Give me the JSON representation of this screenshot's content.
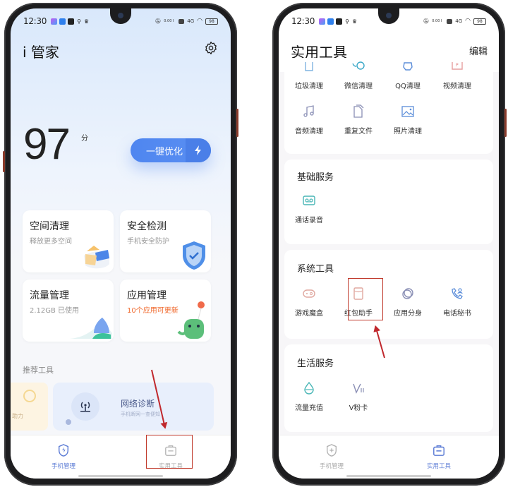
{
  "status_bar": {
    "time": "12:30",
    "network": "4G",
    "speed": "0.00 KB/S",
    "battery": "98"
  },
  "left_screen": {
    "app_title": "i 管家",
    "settings_icon": "gear-icon",
    "score": "97",
    "score_unit": "分",
    "optimize_button": "一键优化",
    "cards": [
      {
        "title": "空间清理",
        "subtitle": "释放更多空间"
      },
      {
        "title": "安全检测",
        "subtitle": "手机安全防护"
      },
      {
        "title": "流量管理",
        "subtitle": "2.12GB 已使用"
      },
      {
        "title": "应用管理",
        "subtitle": "10个应用可更新"
      }
    ],
    "recommended_title": "推荐工具",
    "recommended_partial_label": "助力",
    "recommended_card": {
      "title": "网络诊断",
      "subtitle": "手机断网一查便知"
    },
    "tabs": [
      {
        "label": "手机管理",
        "icon": "shield-bolt-icon",
        "active": true
      },
      {
        "label": "实用工具",
        "icon": "toolbox-icon",
        "active": false
      }
    ]
  },
  "right_screen": {
    "page_title": "实用工具",
    "edit_label": "编辑",
    "clean_tools": [
      {
        "label": "垃圾清理",
        "icon": "trash-icon"
      },
      {
        "label": "微信清理",
        "icon": "wechat-icon"
      },
      {
        "label": "QQ清理",
        "icon": "qq-icon"
      },
      {
        "label": "视频清理",
        "icon": "video-icon"
      },
      {
        "label": "音频清理",
        "icon": "music-icon"
      },
      {
        "label": "重复文件",
        "icon": "duplicate-file-icon"
      },
      {
        "label": "照片清理",
        "icon": "photo-icon"
      }
    ],
    "sections": [
      {
        "title": "基础服务",
        "items": [
          {
            "label": "通话录音",
            "icon": "voicemail-icon"
          }
        ]
      },
      {
        "title": "系统工具",
        "items": [
          {
            "label": "游戏魔盒",
            "icon": "gamepad-icon"
          },
          {
            "label": "红包助手",
            "icon": "red-envelope-icon"
          },
          {
            "label": "应用分身",
            "icon": "app-clone-icon"
          },
          {
            "label": "电话秘书",
            "icon": "phone-secretary-icon"
          }
        ]
      },
      {
        "title": "生活服务",
        "items": [
          {
            "label": "流量充值",
            "icon": "data-topup-icon"
          },
          {
            "label": "V粉卡",
            "icon": "vfan-card-icon"
          }
        ]
      }
    ],
    "tabs": [
      {
        "label": "手机管理",
        "icon": "shield-plus-icon",
        "active": false
      },
      {
        "label": "实用工具",
        "icon": "toolbox-icon",
        "active": true
      }
    ]
  },
  "colors": {
    "accent": "#4f86f0",
    "tab_active": "#5b7bd5",
    "tab_inactive": "#a8a8a8",
    "annotation": "#c0392b",
    "update_orange": "#f06a2e"
  }
}
